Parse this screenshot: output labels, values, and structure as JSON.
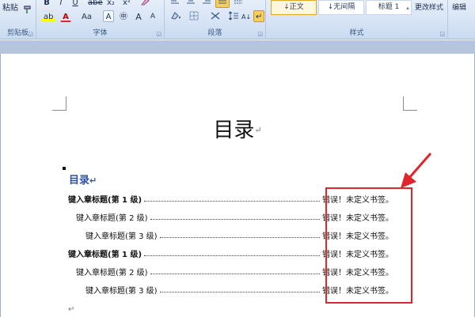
{
  "ribbon": {
    "clipboard": {
      "paste_label": "粘贴",
      "group_label": "剪贴板"
    },
    "font": {
      "group_label": "字体",
      "row1": {
        "bold": "B",
        "italic": "I",
        "underline": "U",
        "strike": "abe",
        "sub": "x₂",
        "sup": "x²"
      },
      "row2": {
        "highlight": "ab",
        "font_color": "A",
        "change_case": "Aa",
        "char_shading": "A",
        "enclose": "㊥",
        "grow": "A",
        "shrink": "A"
      }
    },
    "paragraph": {
      "group_label": "段落",
      "sort": "A↓",
      "show_marks": "↵"
    },
    "styles": {
      "group_label": "样式",
      "items": [
        "↓正文",
        "↓无间隔",
        "标题 1"
      ],
      "change_styles_label": "更改样式"
    },
    "editing": {
      "label": "编辑"
    }
  },
  "document": {
    "title": "目录",
    "paragraph_mark": "↵",
    "toc_heading": "目录",
    "toc_entries": [
      {
        "level": 1,
        "text": "键入章标题(第 1 级)",
        "error": "错误！未定义书签。"
      },
      {
        "level": 2,
        "text": "键入章标题(第 2 级)",
        "error": "错误！未定义书签。"
      },
      {
        "level": 3,
        "text": "键入章标题(第 3 级)",
        "error": "错误！未定义书签。"
      },
      {
        "level": 1,
        "text": "键入章标题(第 1 级)",
        "error": "错误！未定义书签。"
      },
      {
        "level": 2,
        "text": "键入章标题(第 2 级)",
        "error": "错误！未定义书签。"
      },
      {
        "level": 3,
        "text": "键入章标题(第 3 级)",
        "error": "错误！未定义书签。"
      }
    ]
  },
  "colors": {
    "accent": "#2f5496",
    "highlight_border": "#e0252b",
    "arrow": "#e0252b"
  }
}
